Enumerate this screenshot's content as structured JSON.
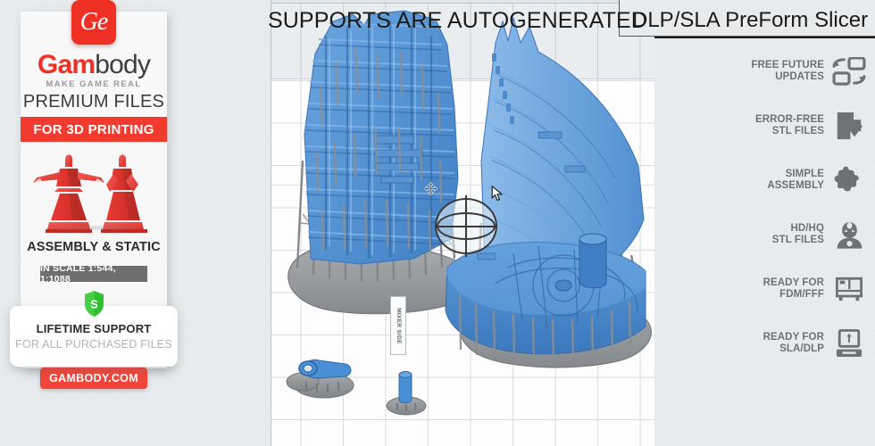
{
  "header": {
    "supports_caption": "SUPPORTS ARE AUTOGENERATED",
    "slicer_caption": "DLP/SLA PreForm Slicer"
  },
  "promo_card": {
    "logo_badge": "Ge",
    "brand_first": "Gam",
    "brand_second": "body",
    "tagline": "MAKE GAME REAL",
    "premium_label": "PREMIUM FILES",
    "red_banner": "FOR 3D PRINTING",
    "assembly_label": "ASSEMBLY & STATIC",
    "scale_chip": "IN SCALE 1:544, 1:1088",
    "support_title": "LIFETIME SUPPORT",
    "support_subtitle": "FOR ALL PURCHASED FILES",
    "website": "GAMBODY.COM",
    "colors": {
      "brand_red": "#ee3124",
      "banner_red": "#f23a2e",
      "button_red": "#f2453a",
      "chip_gray": "#6f6f6f",
      "shield_green": "#2fbf2f",
      "figure_red": "#ef3a35"
    }
  },
  "features": [
    {
      "line1": "FREE FUTURE",
      "line2": "UPDATES",
      "icon": "refresh-squares-icon"
    },
    {
      "line1": "ERROR-FREE",
      "line2": "STL FILES",
      "icon": "document-check-icon"
    },
    {
      "line1": "SIMPLE",
      "line2": "ASSEMBLY",
      "icon": "puzzle-piece-icon"
    },
    {
      "line1": "HD/HQ",
      "line2": "STL FILES",
      "icon": "ironman-bust-icon"
    },
    {
      "line1": "READY FOR",
      "line2": "FDM/FFF",
      "icon": "fdm-printer-icon"
    },
    {
      "line1": "READY FOR",
      "line2": "SLA/DLP",
      "icon": "sla-printer-icon"
    }
  ],
  "viewport": {
    "build_plate_label": "MIXER SIDE",
    "gizmo": "rotation-sphere-gizmo",
    "model_color": "#4a8fd4",
    "support_color": "#8d9194",
    "grid_color": "#d3d6d9",
    "background_color": "#e9edef"
  }
}
